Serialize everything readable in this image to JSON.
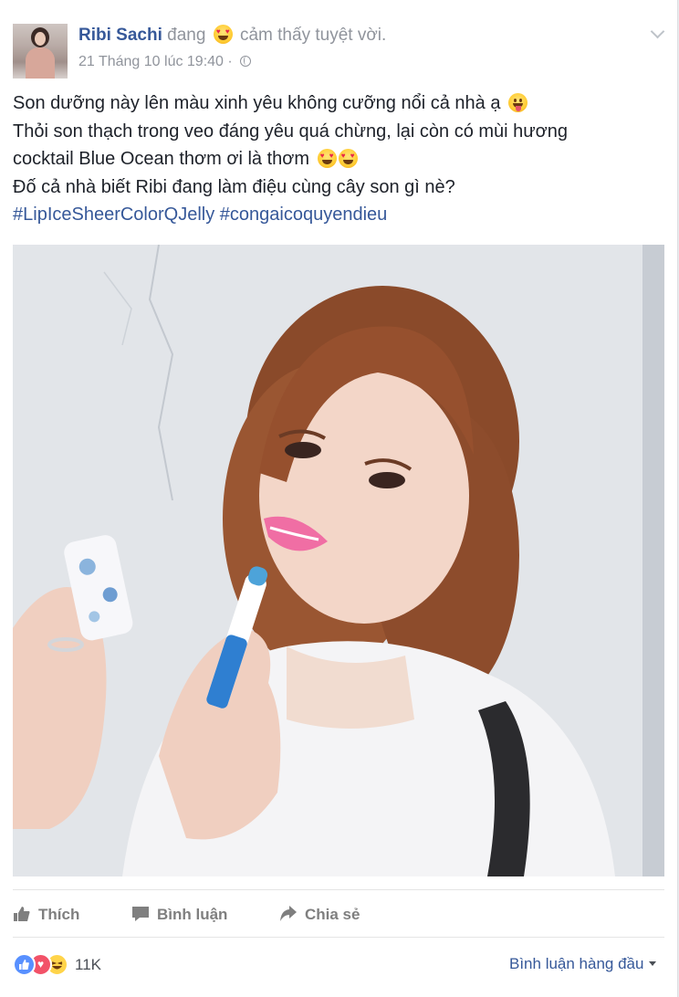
{
  "post": {
    "author": "Ribi Sachi",
    "feeling_prefix": "đang",
    "feeling": "cảm thấy tuyệt vời.",
    "feeling_icon": "heart-eyes-emoji-icon",
    "timestamp": "21 Tháng 10 lúc 19:40",
    "separator": "·",
    "privacy_icon": "globe-icon",
    "options_icon": "chevron-down-icon",
    "text": {
      "line1": "Son dưỡng này lên màu xinh yêu không cưỡng nổi cả nhà ạ",
      "line2": "Thỏi son thạch trong veo đáng yêu quá chừng, lại còn có mùi hương",
      "line3": "cocktail Blue Ocean thơm ơi là thơm",
      "line4": "Đố cả nhà biết Ribi đang làm điệu cùng cây son gì nè?",
      "hashtag1": "#LipIceSheerColorQJelly",
      "hashtag2": "#congaicoquyendieu"
    }
  },
  "actions": {
    "like": "Thích",
    "comment": "Bình luận",
    "share": "Chia sẻ"
  },
  "reactions": {
    "count": "11K",
    "icons": [
      "like-reaction-icon",
      "love-reaction-icon",
      "haha-reaction-icon"
    ]
  },
  "comments": {
    "sort_label": "Bình luận hàng đầu"
  },
  "colors": {
    "link": "#365899",
    "meta": "#90949c",
    "like": "#5890ff",
    "love": "#f25268",
    "haha": "#ffd44a"
  }
}
